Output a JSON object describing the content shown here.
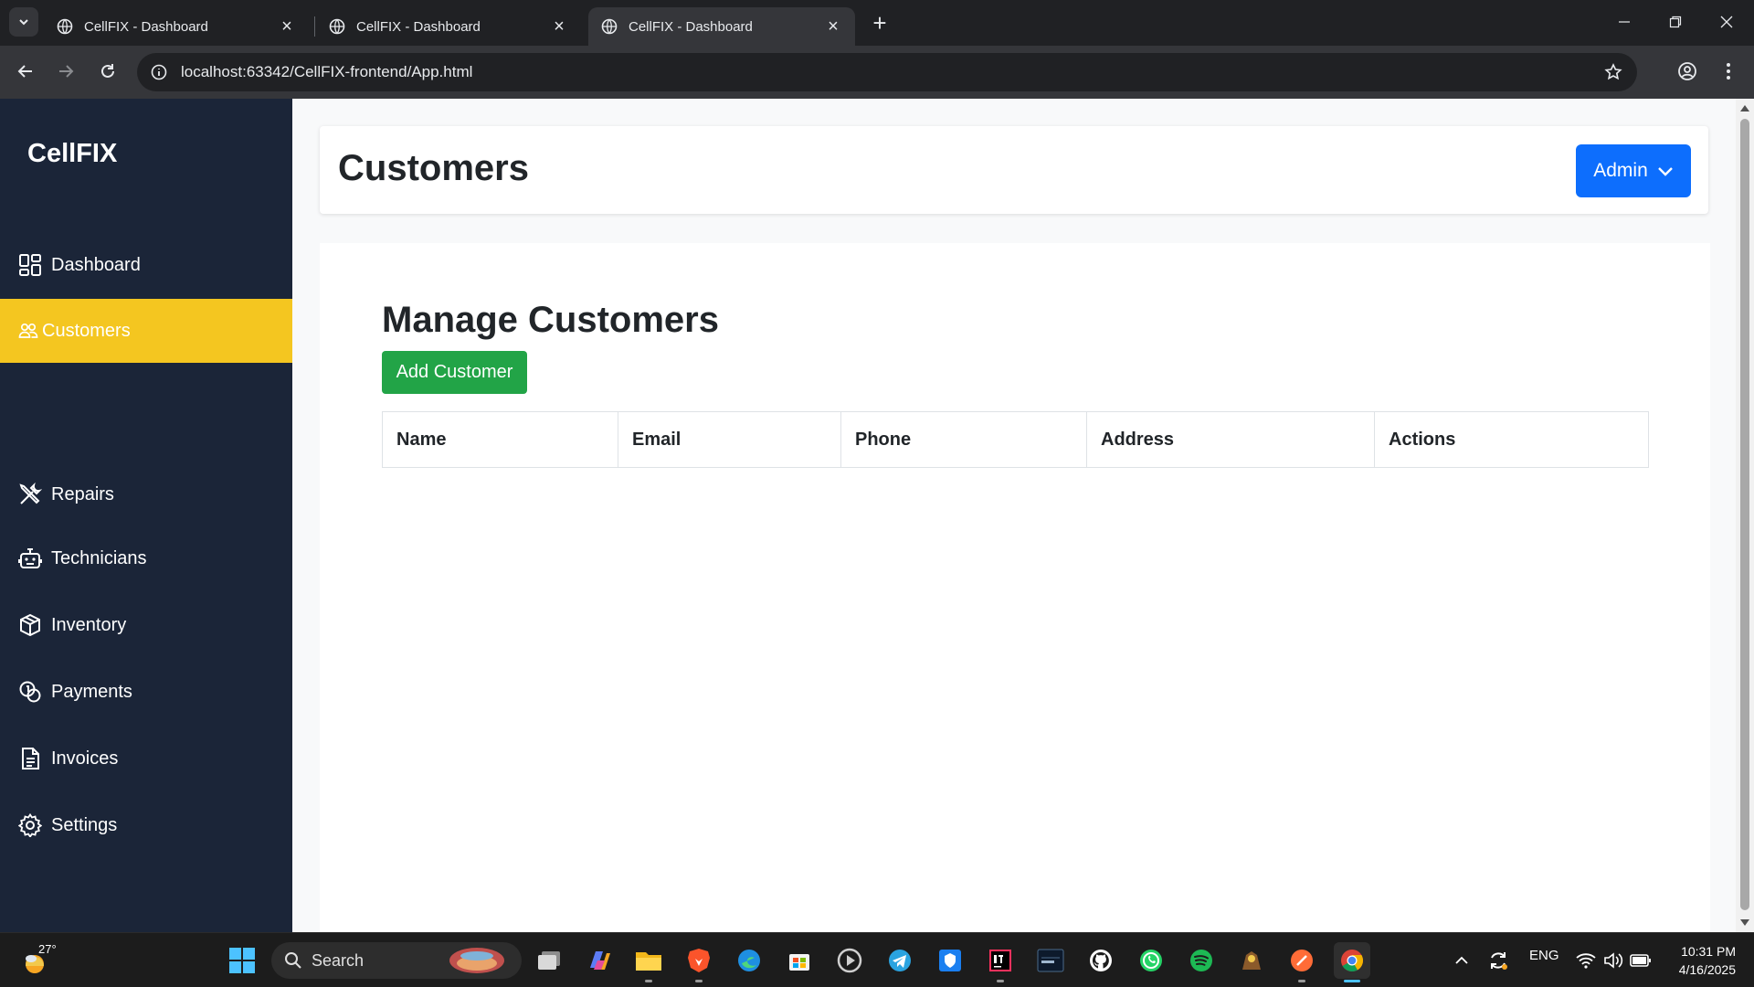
{
  "browser": {
    "tabs": [
      {
        "title": "CellFIX - Dashboard"
      },
      {
        "title": "CellFIX - Dashboard"
      },
      {
        "title": "CellFIX - Dashboard"
      }
    ],
    "active_tab": 2,
    "url": "localhost:63342/CellFIX-frontend/App.html"
  },
  "sidebar": {
    "brand": "CellFIX",
    "items": [
      {
        "label": "Dashboard",
        "icon": "dashboard-icon"
      },
      {
        "label": "Customers",
        "icon": "people-icon",
        "active": true
      },
      {
        "label": "Repairs",
        "icon": "tools-icon"
      },
      {
        "label": "Technicians",
        "icon": "robot-icon"
      },
      {
        "label": "Inventory",
        "icon": "box-icon"
      },
      {
        "label": "Payments",
        "icon": "coins-icon"
      },
      {
        "label": "Invoices",
        "icon": "file-text-icon"
      },
      {
        "label": "Settings",
        "icon": "gear-icon"
      }
    ],
    "active_color": "#f4c620",
    "bg_color": "#1b2538"
  },
  "header": {
    "title": "Customers",
    "user_menu_label": "Admin"
  },
  "main": {
    "section_title": "Manage Customers",
    "add_button_label": "Add Customer",
    "table": {
      "columns": [
        "Name",
        "Email",
        "Phone",
        "Address",
        "Actions"
      ],
      "rows": []
    }
  },
  "taskbar": {
    "weather_temp": "27°",
    "search_label": "Search",
    "language": "ENG",
    "time": "10:31 PM",
    "date": "4/16/2025"
  },
  "colors": {
    "primary": "#0d6efd",
    "success": "#22a447"
  }
}
